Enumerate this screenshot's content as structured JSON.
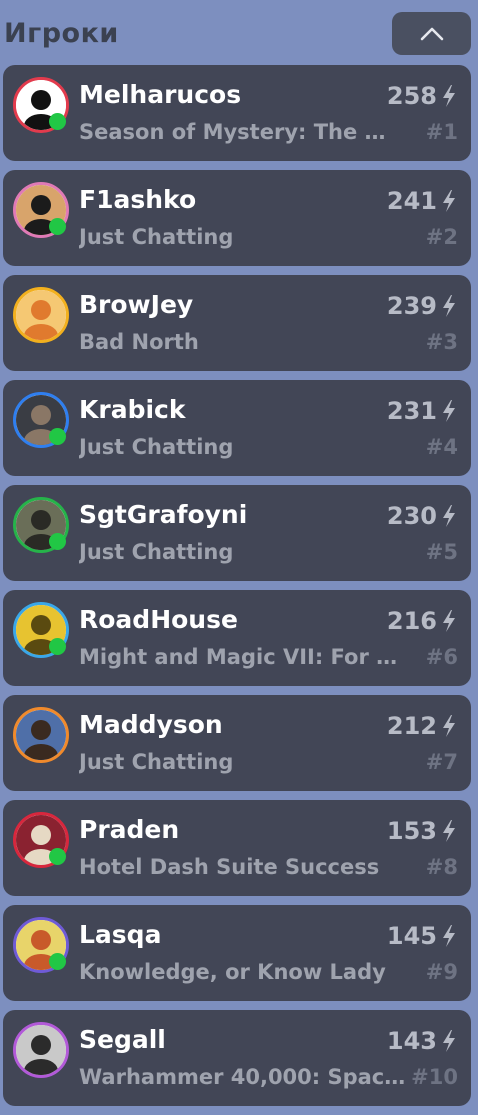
{
  "header": {
    "title": "Игроки",
    "collapse_icon": "chevron-up-icon"
  },
  "players": [
    {
      "name": "Melharucos",
      "game": "Season of Mystery: The …",
      "score": "258",
      "rank": "#1",
      "ring_color": "#e23b4d",
      "online": true,
      "avatar_bg": "#ffffff",
      "avatar_fg": "#111111"
    },
    {
      "name": "F1ashko",
      "game": "Just Chatting",
      "score": "241",
      "rank": "#2",
      "ring_color": "#e07ab6",
      "online": true,
      "avatar_bg": "#d8a46b",
      "avatar_fg": "#1b1b1b"
    },
    {
      "name": "BrowJey",
      "game": "Bad North",
      "score": "239",
      "rank": "#3",
      "ring_color": "#f2b01e",
      "online": false,
      "avatar_bg": "#f5c873",
      "avatar_fg": "#e07a2e"
    },
    {
      "name": "Krabick",
      "game": "Just Chatting",
      "score": "231",
      "rank": "#4",
      "ring_color": "#2f7ff0",
      "online": true,
      "avatar_bg": "#3a3d44",
      "avatar_fg": "#8a7766"
    },
    {
      "name": "SgtGrafoyni",
      "game": "Just Chatting",
      "score": "230",
      "rank": "#5",
      "ring_color": "#26b34a",
      "online": true,
      "avatar_bg": "#6a6e58",
      "avatar_fg": "#2a2a25"
    },
    {
      "name": "RoadHouse",
      "game": "Might and Magic VII: For …",
      "score": "216",
      "rank": "#6",
      "ring_color": "#3aa7e8",
      "online": true,
      "avatar_bg": "#e7c330",
      "avatar_fg": "#5a4a10"
    },
    {
      "name": "Maddyson",
      "game": "Just Chatting",
      "score": "212",
      "rank": "#7",
      "ring_color": "#f08a2c",
      "online": false,
      "avatar_bg": "#4f6fa8",
      "avatar_fg": "#3a2a20"
    },
    {
      "name": "Praden",
      "game": "Hotel Dash Suite Success",
      "score": "153",
      "rank": "#8",
      "ring_color": "#d8273d",
      "online": true,
      "avatar_bg": "#8a2230",
      "avatar_fg": "#e6d9c4"
    },
    {
      "name": "Lasqa",
      "game": "Knowledge, or Know Lady",
      "score": "145",
      "rank": "#9",
      "ring_color": "#6f5bd6",
      "online": true,
      "avatar_bg": "#e8d46a",
      "avatar_fg": "#c85a2a"
    },
    {
      "name": "Segall",
      "game": "Warhammer 40,000: Spac…",
      "score": "143",
      "rank": "#10",
      "ring_color": "#b25ad8",
      "online": false,
      "avatar_bg": "#c9c9c9",
      "avatar_fg": "#2b2b2b"
    }
  ],
  "score_icon": "lightning-bolt-icon",
  "online_color": "#21c745"
}
